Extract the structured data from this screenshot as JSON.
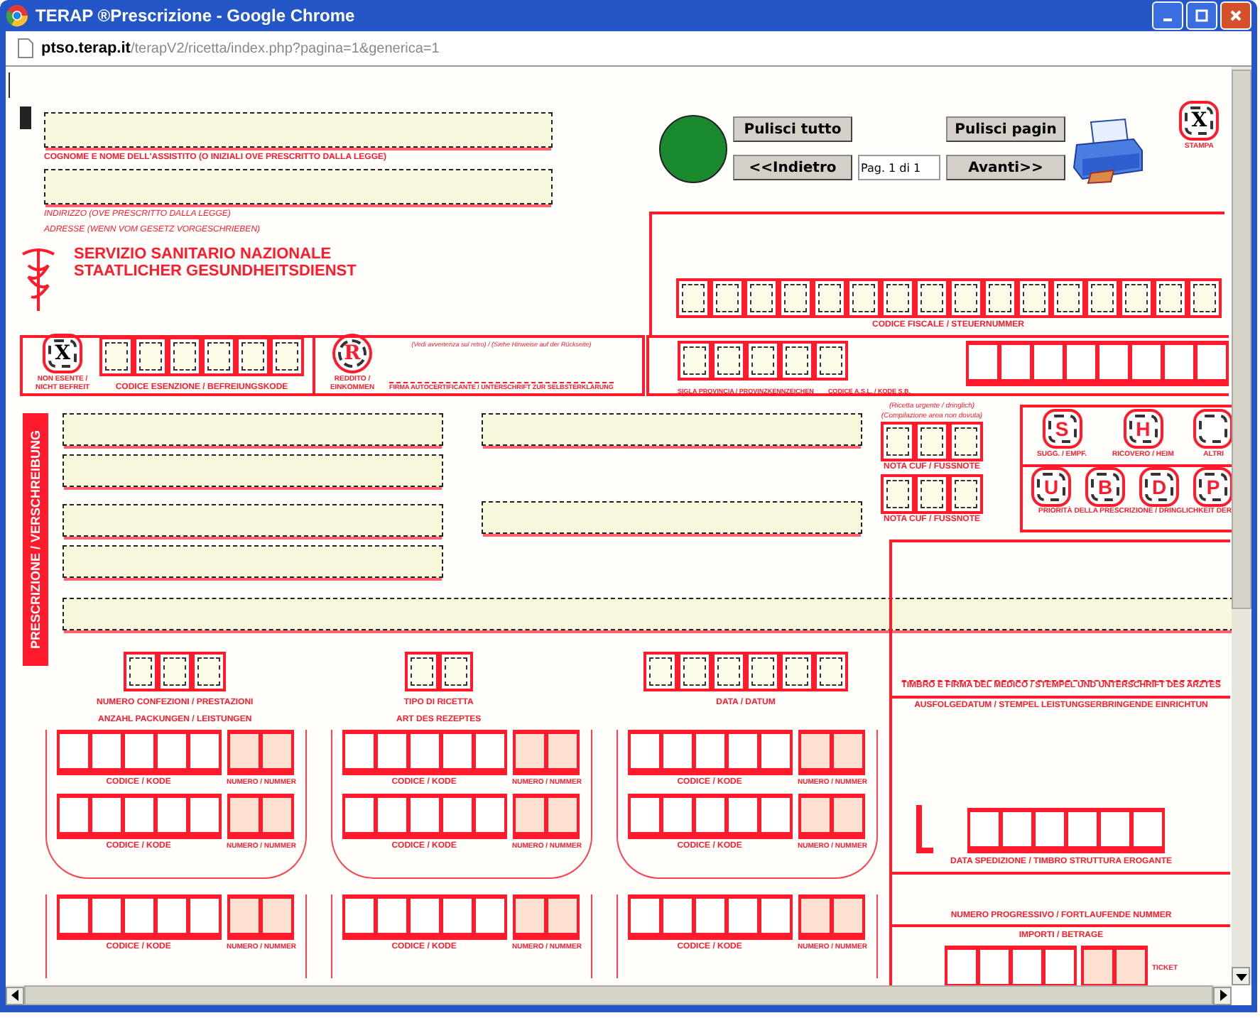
{
  "window": {
    "title": "TERAP ®Prescrizione - Google Chrome"
  },
  "address_bar": {
    "host": "ptso.terap.it",
    "path": "/terapV2/ricetta/index.php?pagina=1&generica=1"
  },
  "controls": {
    "buttons": [
      {
        "label": "Pulisci tutto"
      },
      {
        "label": "Pulisci pagin"
      },
      {
        "label": "<<Indietro"
      },
      {
        "label": "Avanti>>"
      }
    ],
    "page_field": {
      "value": "Pag. 1 di 1"
    },
    "print_close": {
      "glyph": "X",
      "checked": true,
      "caption": "STAMPA"
    }
  },
  "patient": {
    "name_label": "COGNOME E NOME DELL'ASSISTITO (O INIZIALI OVE PRESCRITTO DALLA LEGGE)",
    "address_labels": [
      "INDIRIZZO (OVE PRESCRITTO DALLA LEGGE)",
      "ADRESSE (WENN VOM GESETZ VORGESCHRIEBEN)"
    ]
  },
  "service": [
    "SERVIZIO SANITARIO NAZIONALE",
    "STAATLICHER GESUNDHEITSDIENST"
  ],
  "exemption": {
    "not_exempt": {
      "glyph": "X",
      "checked": true,
      "label": "NON ESENTE / NICHT BEFREIT"
    },
    "code_label": "CODICE ESENZIONE / BEFREIUNGSKODE",
    "income": {
      "glyph": "R",
      "label": "REDDITO / EINKOMMEN"
    },
    "note": "(Vedi avvertenza sul retro) / (Siehe Hinweise auf der Rückseite)",
    "signature_label": "FIRMA AUTOCERTIFICANTE / UNTERSCHRIFT ZUR SELBSTERKLÄRUNG"
  },
  "fiscal_code": {
    "label": "CODICE FISCALE / STEUERNUMMER"
  },
  "region": {
    "province_label": "SIGLA PROVINCIA / PROVINZKENNZEICHEN",
    "asl_label": "CODICE A.S.L. / KODE S.B."
  },
  "prescription": {
    "title": "PRESCRIZIONE / VERSCHREIBUNG",
    "packs_labels": [
      "NUMERO CONFEZIONI / PRESTAZIONI",
      "ANZAHL PACKUNGEN / LEISTUNGEN"
    ],
    "type_labels": [
      "TIPO DI RICETTA",
      "ART DES REZEPTES"
    ],
    "date_label": "DATA / DATUM"
  },
  "notes": {
    "captions": [
      "(Ricetta urgente / dringlich)",
      "(Compilazione area non dovuta)"
    ],
    "labels": [
      "NOTA CUF / FUSSNOTE",
      "NOTA CUF / FUSSNOTE"
    ]
  },
  "access": {
    "options": [
      {
        "glyph": "S",
        "label": "SUGG. / EMPF."
      },
      {
        "glyph": "H",
        "label": "RICOVERO / HEIM"
      },
      {
        "label": "ALTRI"
      }
    ],
    "priorities": [
      {
        "glyph": "U"
      },
      {
        "glyph": "B"
      },
      {
        "glyph": "D"
      },
      {
        "glyph": "P"
      }
    ],
    "priority_label": "PRIORITÀ DELLA PRESCRIZIONE / DRINGLICHKEIT DER"
  },
  "doctor": {
    "stamp_label": "TIMBRO E FIRMA DEL MEDICO / STEMPEL UND UNTERSCHRIFT DES ARZTES",
    "delivery_label": "AUSFOLGEDATUM / STEMPEL LEISTUNGSERBRINGENDE EINRICHTUN",
    "dispatch_label": "DATA SPEDIZIONE / TIMBRO STRUTTURA EROGANTE",
    "progressive_label": "NUMERO PROGRESSIVO / FORTLAUFENDE NUMMER",
    "amounts_label": "IMPORTI / BETRAGE",
    "ticket_label": "TICKET"
  },
  "code_groups": [
    {
      "rows": [
        {
          "code_label": "CODICE / KODE",
          "number_label": "NUMERO / NUMMER"
        },
        {
          "code_label": "CODICE / KODE",
          "number_label": "NUMERO / NUMMER"
        }
      ]
    },
    {
      "rows": [
        {
          "code_label": "CODICE / KODE",
          "number_label": "NUMERO / NUMMER"
        },
        {
          "code_label": "CODICE / KODE",
          "number_label": "NUMERO / NUMMER"
        }
      ]
    },
    {
      "rows": [
        {
          "code_label": "CODICE / KODE",
          "number_label": "NUMERO / NUMMER"
        },
        {
          "code_label": "CODICE / KODE",
          "number_label": "NUMERO / NUMMER"
        }
      ]
    }
  ],
  "code_groups_lower": [
    {
      "rows": [
        {
          "code_label": "CODICE / KODE",
          "number_label": "NUMERO / NUMMER"
        }
      ]
    },
    {
      "rows": [
        {
          "code_label": "CODICE / KODE",
          "number_label": "NUMERO / NUMMER"
        }
      ]
    },
    {
      "rows": [
        {
          "code_label": "CODICE / KODE",
          "number_label": "NUMERO / NUMMER"
        }
      ]
    }
  ]
}
